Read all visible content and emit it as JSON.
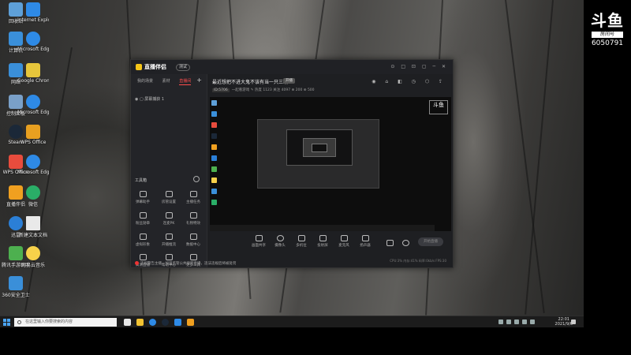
{
  "desktop": {
    "icons": [
      {
        "label": "回收站",
        "color": "#5ea0d8"
      },
      {
        "label": "计算机",
        "color": "#3a8fd9"
      },
      {
        "label": "网络",
        "color": "#3a8fd9"
      },
      {
        "label": "控制面板",
        "color": "#7aa0c8"
      },
      {
        "label": "Steam",
        "color": "#1b2838"
      },
      {
        "label": "WPS Office",
        "color": "#e84c3d"
      },
      {
        "label": "直播伴侣",
        "color": "#f0a020"
      },
      {
        "label": "微信",
        "color": "#2aae67"
      },
      {
        "label": "迅雷",
        "color": "#2b7fd6"
      },
      {
        "label": "新建文本文档",
        "color": "#e9e9e9"
      },
      {
        "label": "腾讯手游助手",
        "color": "#4db04f"
      },
      {
        "label": "网易云音乐",
        "color": "#f7d14a"
      },
      {
        "label": "360安全卫士",
        "color": "#3a8fd9"
      },
      {
        "label": "Microsoft Edge",
        "color": "#2e8ae6"
      },
      {
        "label": "Google Chrome",
        "color": "#e7c63b"
      },
      {
        "label": "Internet Explorer",
        "color": "#2e8ae6"
      }
    ]
  },
  "streamer_logo": {
    "mark": "斗鱼",
    "sub": "房间号",
    "room_id": "6050791"
  },
  "app": {
    "brand": "直播伴侣",
    "version": "测试",
    "window_buttons": "⊙ □ ⊡ ▢ ─ ✕",
    "tabs": [
      "我的场景",
      "素材",
      "直播间"
    ],
    "active_tab_index": 2,
    "add_label": "+",
    "layer_item": "屏幕捕获 1",
    "tools_header": "工具箱",
    "tools": [
      {
        "label": "弹幕助手"
      },
      {
        "label": "房管设置"
      },
      {
        "label": "主播任务"
      },
      {
        "label": "粉丝勋章"
      },
      {
        "label": "连麦PK"
      },
      {
        "label": "礼物特效"
      },
      {
        "label": "虚拟形象"
      },
      {
        "label": "开播推流"
      },
      {
        "label": "数据中心"
      },
      {
        "label": "高清直播"
      },
      {
        "label": "帮助中心"
      },
      {
        "label": "更多工具"
      }
    ],
    "warning": "违规警告主播，加强监管公共场所直播，违法违规后将被处罚",
    "room_title": "最近想把不进大鬼不该有当一只三编",
    "room_tag": "开播",
    "room_id_tag": "ID:5706",
    "room_meta": "一起看游戏 ✎  热度 1123  关注 4097  ⊕ 200  ⊕ 500",
    "room_icons": "◉ ⌂ ◧ ◷ ⬡ ⇪",
    "preview_logo": "斗鱼",
    "controls": [
      {
        "label": "画面共享"
      },
      {
        "label": "摄像头"
      },
      {
        "label": "多机位"
      },
      {
        "label": "投射屏"
      },
      {
        "label": "麦克风"
      },
      {
        "label": "扬声器"
      }
    ],
    "go_live": "开始直播",
    "status": "CPU:3%  内存:41%  码率:0kb/s  FPS:30"
  },
  "taskbar": {
    "search_placeholder": "在这里输入你要搜索的内容",
    "apps": [
      "#e8e8e8",
      "#f1c232",
      "#2e8ae6",
      "#1b2838",
      "#2e8ae6",
      "#f0a020"
    ],
    "time": "22:01",
    "date": "2021/9/6"
  }
}
